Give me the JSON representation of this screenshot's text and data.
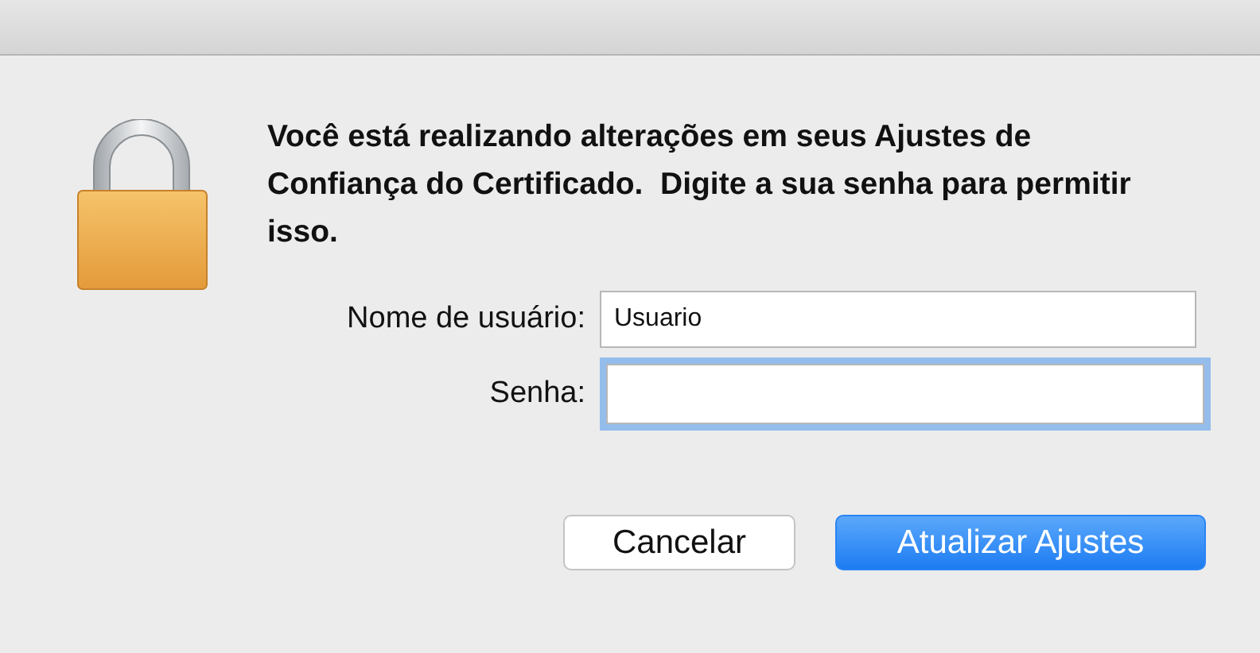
{
  "message": "Você está realizando alterações em seus Ajustes de Confiança do Certificado.  Digite a sua senha para permitir isso.",
  "fields": [
    {
      "label": "Nome de usuário:",
      "value": "Usuario",
      "focused": false
    },
    {
      "label": "Senha:",
      "focused": true
    }
  ],
  "buttons": [
    {
      "label": "Cancelar",
      "kind": "normal"
    },
    {
      "label": "Atualizar Ajustes",
      "kind": "default"
    }
  ]
}
